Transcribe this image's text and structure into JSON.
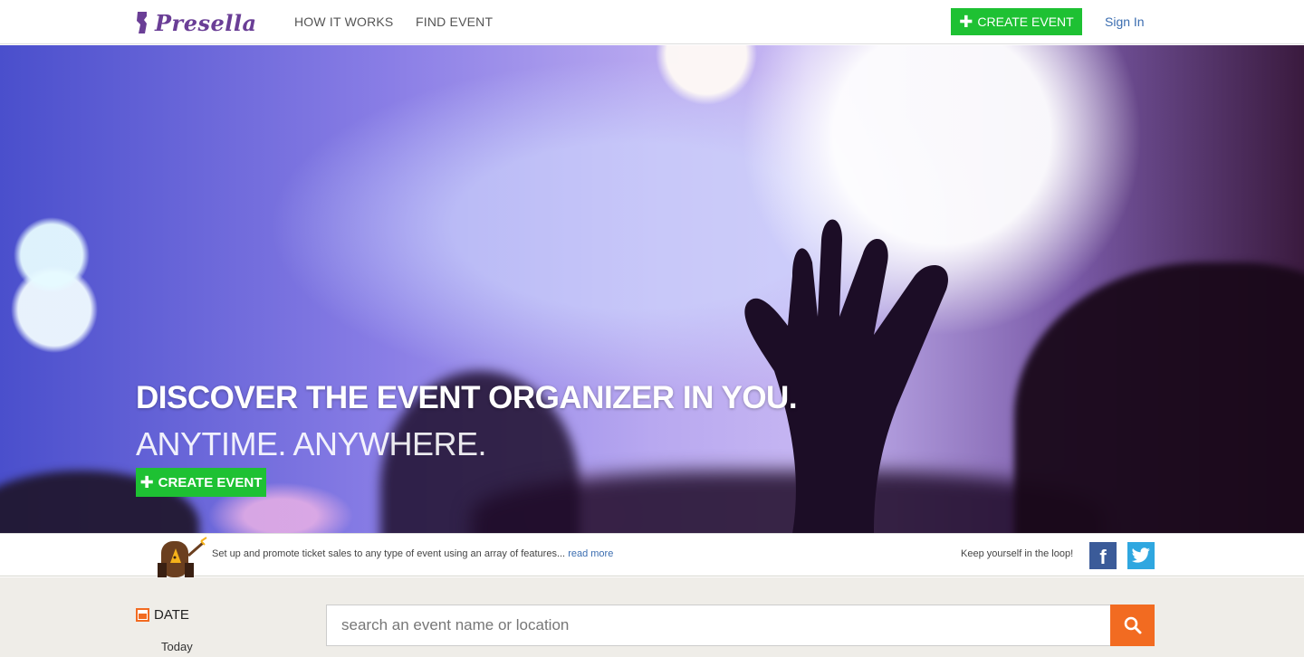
{
  "nav": {
    "logo_text": "Presella",
    "links": [
      {
        "label": "HOW IT WORKS"
      },
      {
        "label": "FIND EVENT"
      }
    ],
    "create_event_label": "CREATE EVENT",
    "sign_in_label": "Sign In"
  },
  "hero": {
    "title": "DISCOVER THE EVENT ORGANIZER IN YOU.",
    "subtitle": "ANYTIME. ANYWHERE.",
    "create_event_label": "CREATE EVENT"
  },
  "info": {
    "tagline": "Set up and promote ticket sales to any type of event using an array of features...",
    "read_more": "read more",
    "keep_loop": "Keep yourself in the loop!",
    "social": [
      {
        "name": "facebook",
        "glyph": "f"
      },
      {
        "name": "twitter",
        "glyph": ""
      }
    ]
  },
  "filters": {
    "date_label": "DATE",
    "date_options": [
      "Today"
    ]
  },
  "search": {
    "placeholder": "search an event name or location"
  },
  "colors": {
    "brand_purple": "#6a3e96",
    "accent_green": "#1ec133",
    "link_blue": "#3b6db0",
    "search_orange": "#f26b21",
    "facebook_blue": "#3b5b99",
    "twitter_blue": "#2fa7e0"
  },
  "icons": [
    "logo-icon",
    "plus-icon",
    "facebook-icon",
    "twitter-icon",
    "calendar-icon",
    "search-icon",
    "mascot-icon"
  ]
}
